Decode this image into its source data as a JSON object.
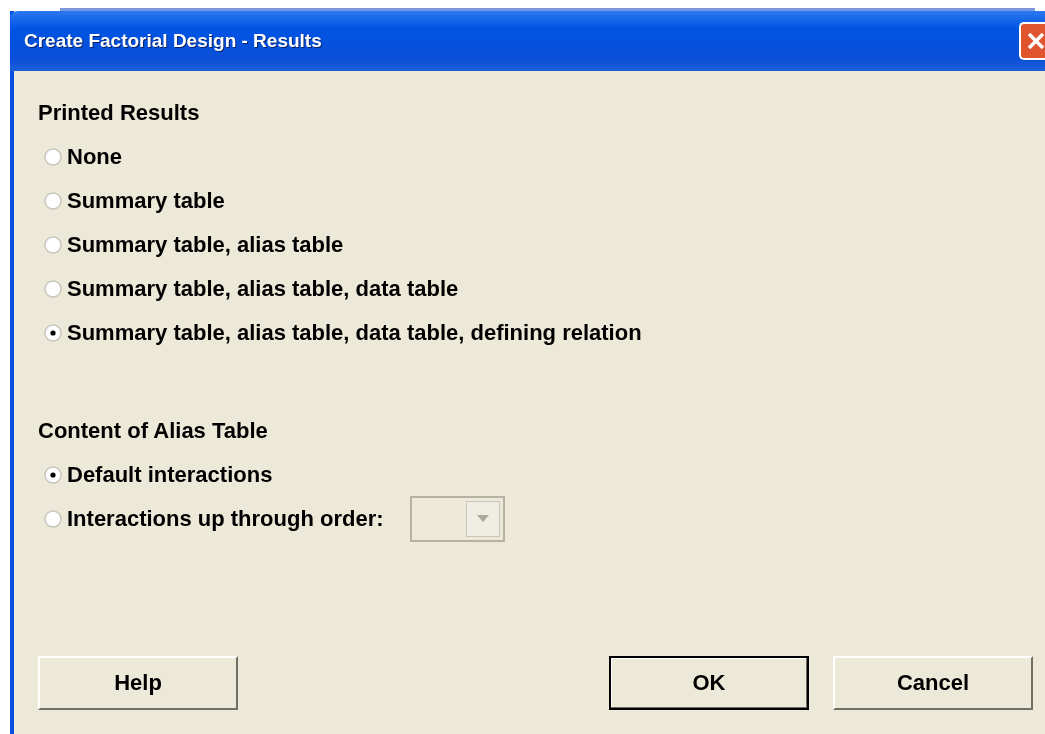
{
  "window": {
    "title": "Create Factorial Design - Results"
  },
  "sections": [
    {
      "heading": "Printed Results",
      "options": [
        {
          "label": "None",
          "selected": false
        },
        {
          "label": "Summary table",
          "selected": false
        },
        {
          "label": "Summary table, alias table",
          "selected": false
        },
        {
          "label": "Summary table, alias table, data table",
          "selected": false
        },
        {
          "label": "Summary table, alias table, data table, defining relation",
          "selected": true
        }
      ]
    },
    {
      "heading": "Content of Alias Table",
      "options": [
        {
          "label": "Default interactions",
          "selected": true
        },
        {
          "label": "Interactions up through order:",
          "selected": false,
          "dropdown": {
            "disabled": true
          }
        }
      ]
    }
  ],
  "buttons": [
    {
      "label": "Help",
      "default": false
    },
    {
      "label": "OK",
      "default": true
    },
    {
      "label": "Cancel",
      "default": false
    }
  ]
}
